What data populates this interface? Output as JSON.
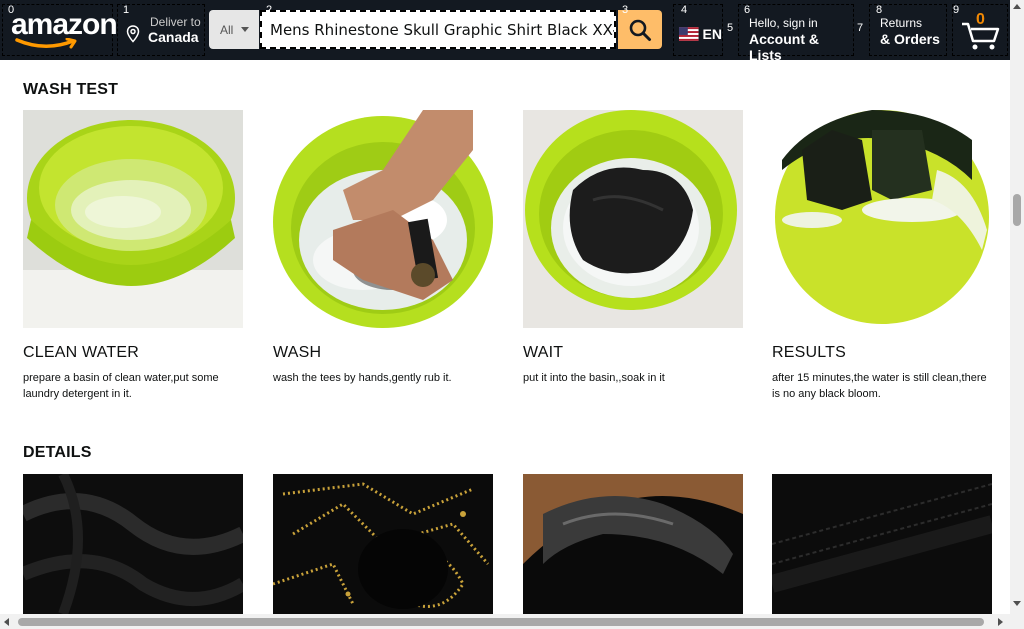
{
  "header": {
    "markers": [
      "0",
      "1",
      "2",
      "3",
      "4",
      "5",
      "6",
      "7",
      "8",
      "9"
    ],
    "logo_text": "amazon",
    "deliver": {
      "small": "Deliver to",
      "big": "Canada"
    },
    "search": {
      "category": "All",
      "query": "Mens Rhinestone Skull Graphic Shirt Black XX-Large"
    },
    "language": {
      "code": "EN"
    },
    "account": {
      "small": "Hello, sign in",
      "big": "Account & Lists"
    },
    "orders": {
      "small": "Returns",
      "big": "& Orders"
    },
    "cart": {
      "count": "0"
    },
    "colors": {
      "background": "#131921",
      "search_button": "#febd69",
      "cart_count": "#f08804"
    }
  },
  "wash_test": {
    "title": "WASH TEST",
    "cards": [
      {
        "name": "CLEAN WATER",
        "desc": "prepare a basin of clean water,put some laundry detergent in it."
      },
      {
        "name": "WASH",
        "desc": "wash the tees by hands,gently rub it."
      },
      {
        "name": "WAIT",
        "desc": "put it into the basin,,soak in it"
      },
      {
        "name": "RESULTS",
        "desc": "after 15 minutes,the water is still clean,there is no any black bloom."
      }
    ]
  },
  "details": {
    "title": "DETAILS"
  }
}
